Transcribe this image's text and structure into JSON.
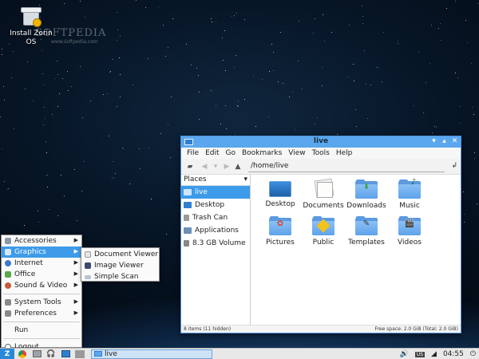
{
  "desktop": {
    "icon_label": "Install Zorin OS",
    "watermark": "SOFTPEDIA",
    "watermark_url": "www.softpedia.com"
  },
  "window": {
    "title": "live",
    "menu": [
      "File",
      "Edit",
      "Go",
      "Bookmarks",
      "View",
      "Tools",
      "Help"
    ],
    "path": "/home/live",
    "places_header": "Places",
    "places": [
      {
        "label": "live",
        "icon": "home-folder-icon",
        "color": "#5aa7ee"
      },
      {
        "label": "Desktop",
        "icon": "desktop-icon",
        "color": "#2f7fd0"
      },
      {
        "label": "Trash Can",
        "icon": "trash-icon",
        "color": "#9a9a9a"
      },
      {
        "label": "Applications",
        "icon": "applications-icon",
        "color": "#6b8fb5"
      },
      {
        "label": "8.3 GB Volume",
        "icon": "drive-icon",
        "color": "#888888"
      }
    ],
    "files": [
      {
        "label": "Desktop",
        "icon": "desktop-folder-icon"
      },
      {
        "label": "Documents",
        "icon": "documents-folder-icon"
      },
      {
        "label": "Downloads",
        "icon": "downloads-folder-icon"
      },
      {
        "label": "Music",
        "icon": "music-folder-icon"
      },
      {
        "label": "Pictures",
        "icon": "pictures-folder-icon"
      },
      {
        "label": "Public",
        "icon": "public-folder-icon"
      },
      {
        "label": "Templates",
        "icon": "templates-folder-icon"
      },
      {
        "label": "Videos",
        "icon": "videos-folder-icon"
      }
    ],
    "status_left": "8 items (11 hidden)",
    "status_right": "Free space: 2.0 GiB (Total: 2.0 GiB)"
  },
  "start_menu": {
    "items": [
      {
        "label": "Accessories",
        "has_submenu": true,
        "color": "#8a9aa8"
      },
      {
        "label": "Graphics",
        "has_submenu": true,
        "color": "#4a7fbf"
      },
      {
        "label": "Internet",
        "has_submenu": true,
        "color": "#3c78c8"
      },
      {
        "label": "Office",
        "has_submenu": true,
        "color": "#5aa84a"
      },
      {
        "label": "Sound & Video",
        "has_submenu": true,
        "color": "#c85a3c"
      }
    ],
    "items2": [
      {
        "label": "System Tools",
        "has_submenu": true,
        "color": "#8a8a8a"
      },
      {
        "label": "Preferences",
        "has_submenu": true,
        "color": "#8a8a8a"
      }
    ],
    "run": "Run",
    "logout": "Logout",
    "submenu": [
      "Document Viewer",
      "Image Viewer",
      "Simple Scan"
    ]
  },
  "taskbar": {
    "start_glyph": "Z",
    "task_label": "live",
    "keyboard": "US",
    "clock": "04:55"
  },
  "colors": {
    "accent": "#3d9be9",
    "titlebar": "#5aa7ee",
    "folder": "#5ea3ea"
  }
}
